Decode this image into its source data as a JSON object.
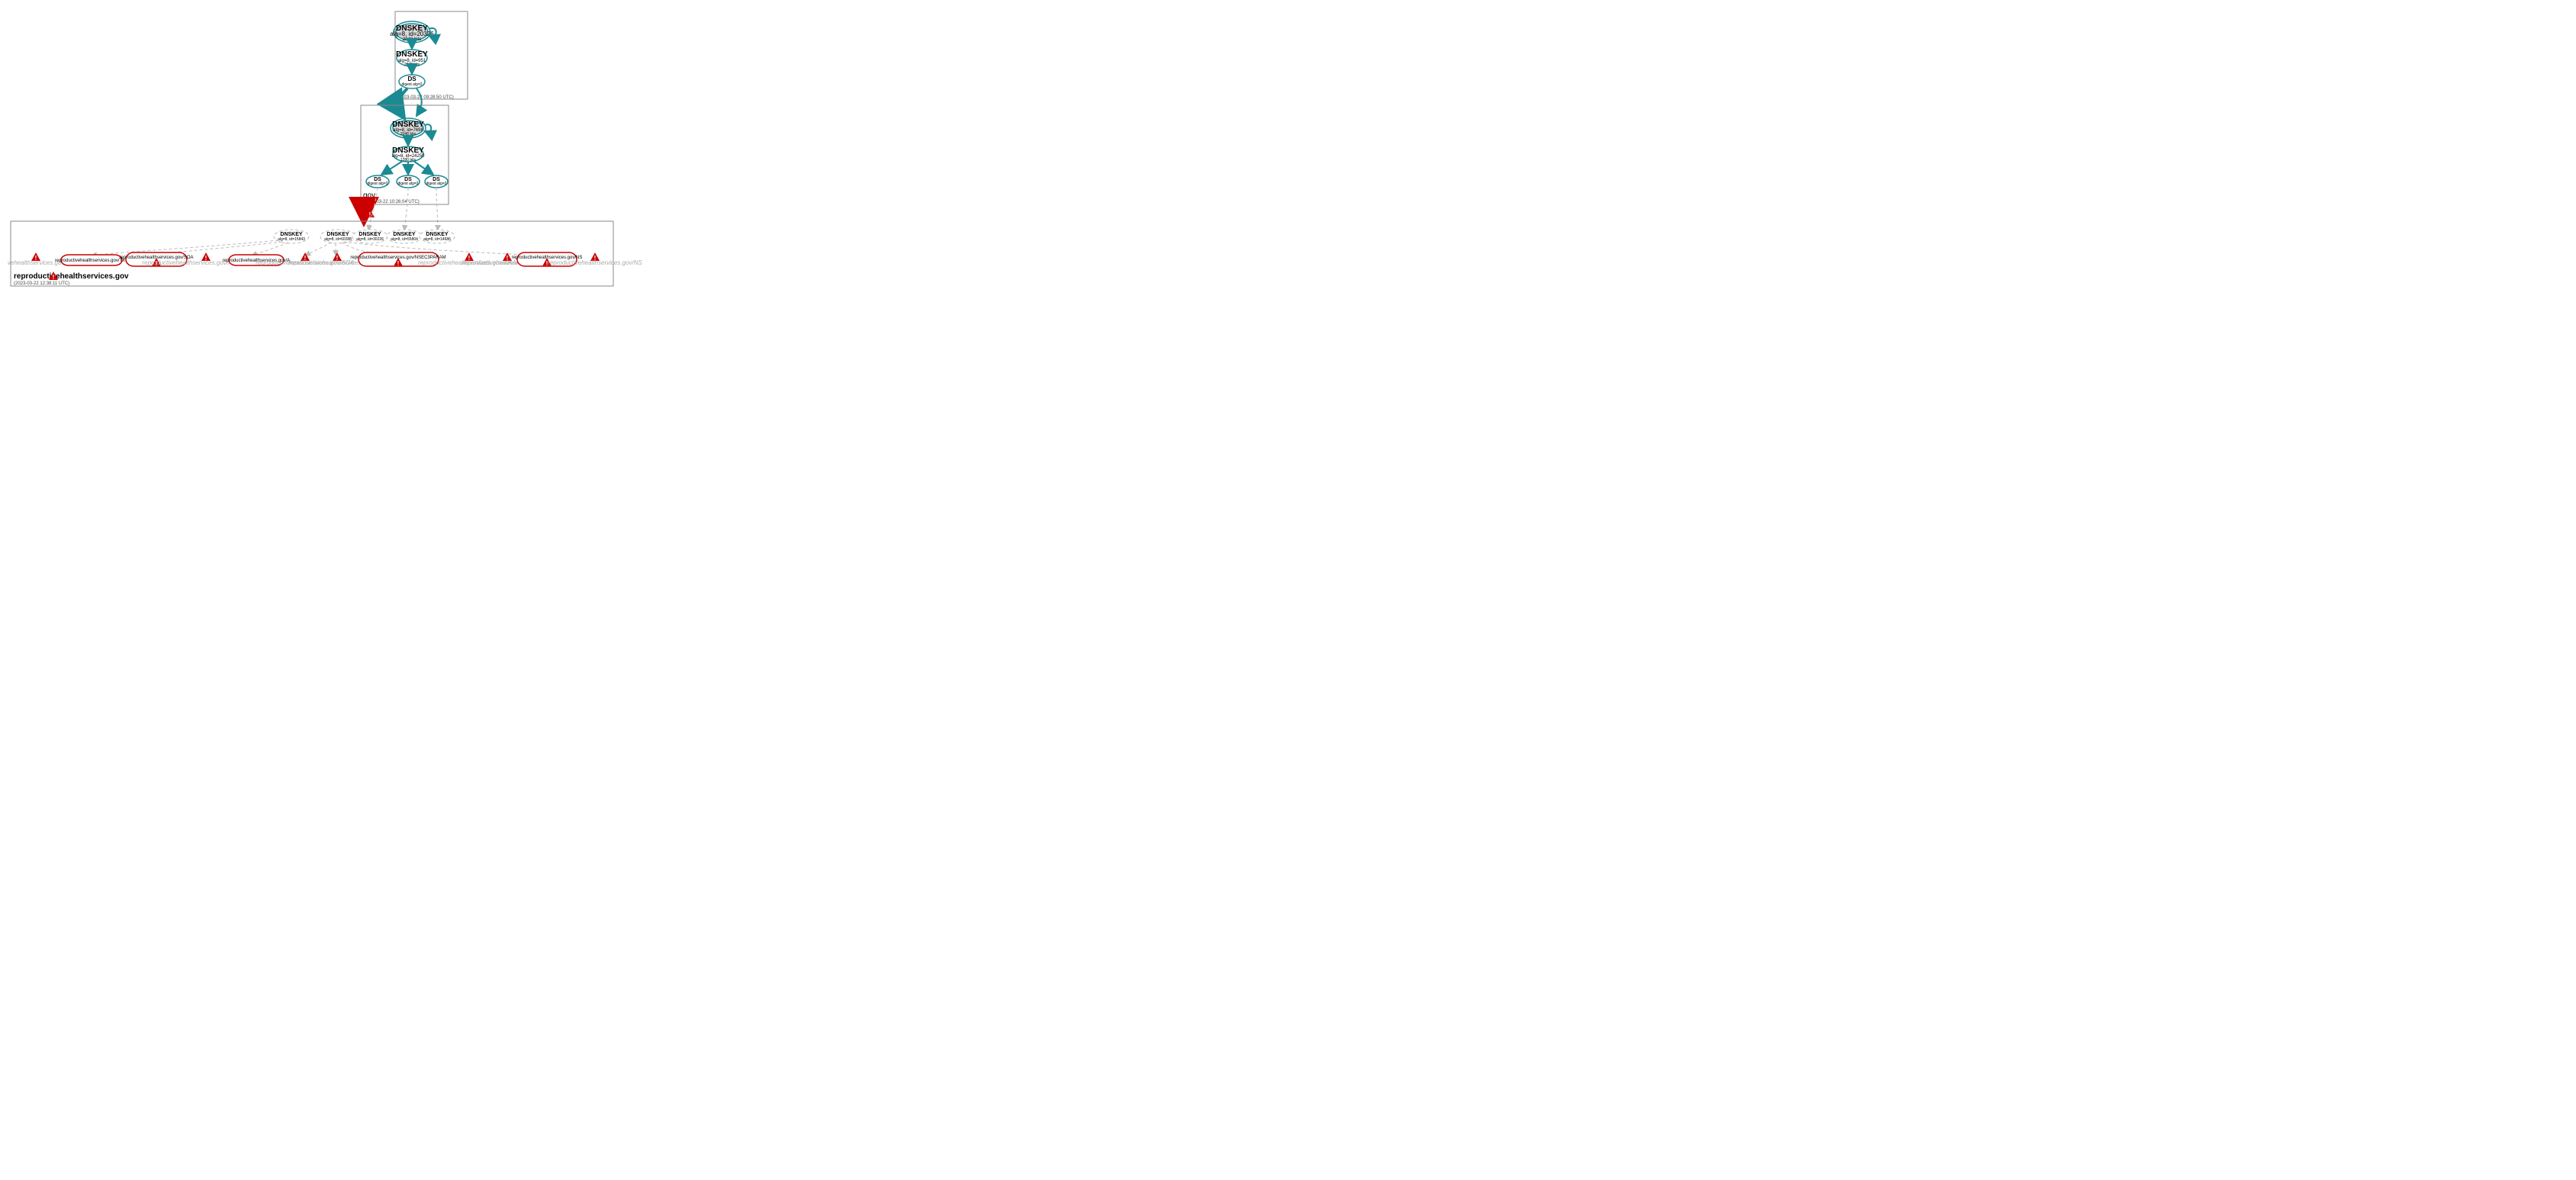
{
  "zones": {
    "root": {
      "title": ".",
      "timestamp": "(2023-03-22 09:28:50 UTC)",
      "ksk": {
        "type": "DNSKEY",
        "detail": "alg=8, id=20326",
        "bits": "2048 bits"
      },
      "zsk": {
        "type": "DNSKEY",
        "detail": "alg=8, id=951",
        "bits": "2048 bits"
      },
      "ds": {
        "type": "DS",
        "detail": "digest alg=2"
      }
    },
    "gov": {
      "title": "gov",
      "timestamp": "(2023-03-22 10:26:04 UTC)",
      "ksk": {
        "type": "DNSKEY",
        "detail": "alg=8, id=7698",
        "bits": "2048 bits"
      },
      "zsk": {
        "type": "DNSKEY",
        "detail": "alg=8, id=24250",
        "bits": "1280 bits"
      },
      "ds1": {
        "type": "DS",
        "detail": "digest alg=2"
      },
      "ds2": {
        "type": "DS",
        "detail": "digest alg=2"
      },
      "ds3": {
        "type": "DS",
        "detail": "digest alg=2"
      }
    },
    "domain": {
      "title": "reproductivehealthservices.gov",
      "timestamp": "(2023-03-22 12:38:11 UTC)",
      "dnskeys": [
        {
          "type": "DNSKEY",
          "detail": "alg=8, id=15843"
        },
        {
          "type": "DNSKEY",
          "detail": "alg=8, id=60288"
        },
        {
          "type": "DNSKEY",
          "detail": "alg=8, id=30226"
        },
        {
          "type": "DNSKEY",
          "detail": "alg=8, id=55804"
        },
        {
          "type": "DNSKEY",
          "detail": "alg=8, id=14686"
        }
      ],
      "rrsets_bogus": [
        "reproductivehealthservices.gov/TXT",
        "reproductivehealthservices.gov/SOA",
        "reproductivehealthservices.gov/A",
        "reproductivehealthservices.gov/NSEC3PARAM",
        "reproductivehealthservices.gov/NS"
      ],
      "rrsets_faded": [
        "reproductivehealthservices.gov/DNSKEY",
        "reproductivehealthservices.gov/NSEC3PARAM",
        "reproductivehealthservices.gov/SOA",
        "reproductivehealthservices.gov/TXT",
        "reproductivehealthservices.gov/AAAA",
        "reproductivehealthservices.gov/A",
        "reproductivehealthservices.gov/NS"
      ]
    }
  }
}
